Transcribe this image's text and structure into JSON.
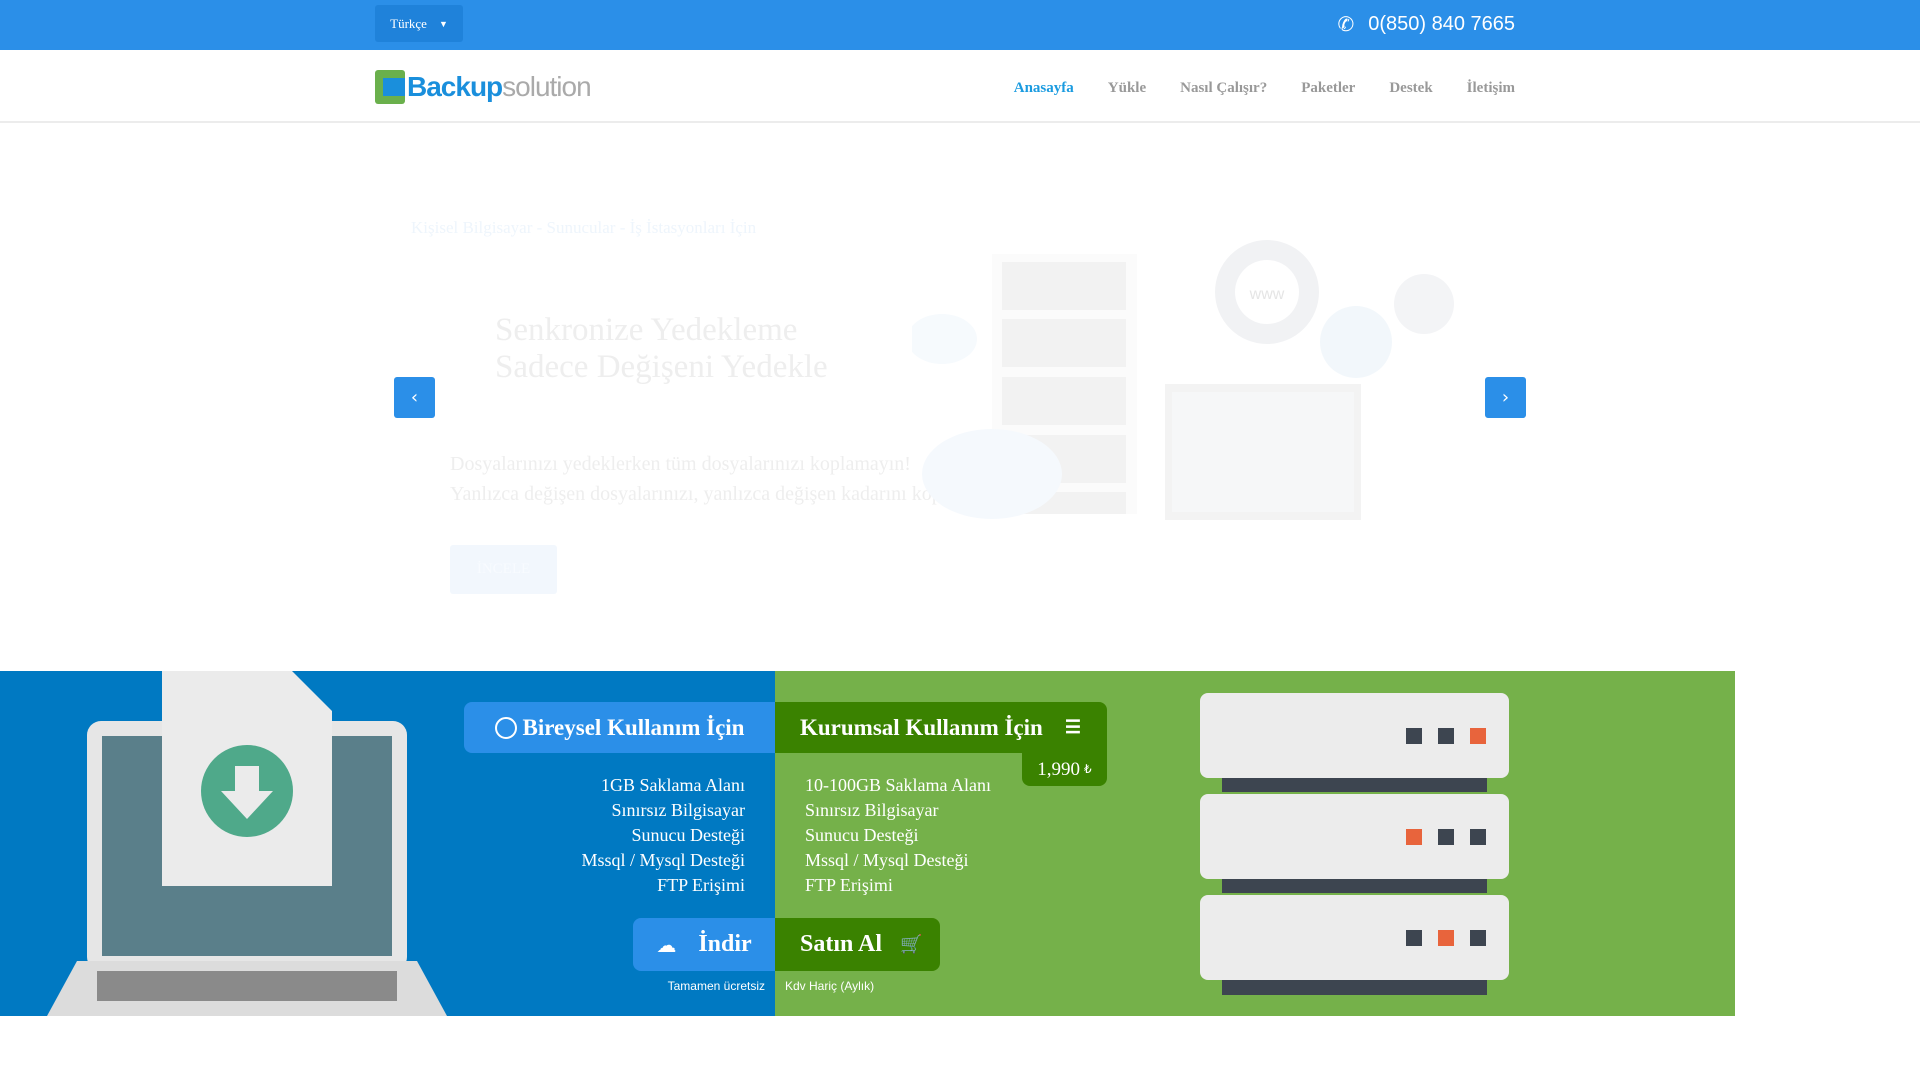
{
  "topbar": {
    "language": "Türkçe",
    "phone": "0(850) 840 7665"
  },
  "logo": {
    "part1": "Backup",
    "part2": "solution"
  },
  "nav": [
    "Anasayfa",
    "Yükle",
    "Nasıl Çalışır?",
    "Paketler",
    "Destek",
    "İletişim"
  ],
  "hero": {
    "subtitle": "Kişisel Bilgisayar - Sunucular - İş İstasyonları İçin",
    "title1": "Senkronize Yedekleme",
    "title2": "Sadece Değişeni Yedekle",
    "text1": "Dosyalarınızı yedeklerken tüm dosyalarınızı koplamayın!",
    "text2": "Yanlızca değişen dosyalarınızı, yanlızca değişen kadarını kopyalayın.",
    "button": "İNCELE",
    "illustration_text": "www"
  },
  "personal": {
    "title": "Bireysel Kullanım İçin",
    "features": [
      "1GB Saklama Alanı",
      "Sınırsız Bilgisayar",
      "Sunucu Desteği",
      "Mssql / Mysql Desteği",
      "FTP Erişimi"
    ],
    "button": "İndir",
    "caption": "Tamamen ücretsiz"
  },
  "corporate": {
    "title": "Kurumsal Kullanım İçin",
    "price": "1,990",
    "currency": "₺",
    "features": [
      "10-100GB Saklama Alanı",
      "Sınırsız Bilgisayar",
      "Sunucu Desteği",
      "Mssql / Mysql Desteği",
      "FTP Erişimi"
    ],
    "button": "Satın Al",
    "caption": "Kdv Hariç (Aylık)"
  },
  "colors": {
    "blue": "#2b8fe8",
    "darkblue": "#0079c2",
    "green": "#75b14a",
    "darkgreen": "#3a8200"
  }
}
